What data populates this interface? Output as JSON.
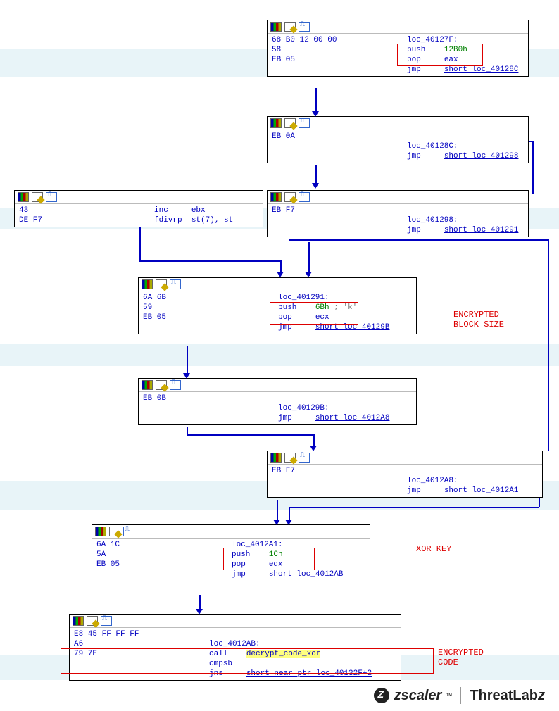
{
  "nodes": {
    "n1": {
      "hex": "68 B0 12 00 00\n58\nEB 05",
      "loc": "loc_40127F:",
      "lines": [
        {
          "m": "push",
          "o": "12B0h",
          "imm": true
        },
        {
          "m": "pop",
          "o": "eax"
        },
        {
          "m": "jmp",
          "o": "short loc_40128C"
        }
      ]
    },
    "n2": {
      "hex": "EB 0A",
      "loc": "loc_40128C:",
      "lines": [
        {
          "m": "jmp",
          "o": "short loc_401298"
        }
      ]
    },
    "n3a": {
      "hex": "43\nDE F7",
      "lines": [
        {
          "m": "inc",
          "o": "ebx"
        },
        {
          "m": "fdivrp",
          "o": "st(7), st"
        }
      ]
    },
    "n3b": {
      "hex": "EB F7",
      "loc": "loc_401298:",
      "lines": [
        {
          "m": "jmp",
          "o": "short loc_401291"
        }
      ]
    },
    "n4": {
      "hex": "6A 6B\n59\nEB 05",
      "loc": "loc_401291:",
      "lines": [
        {
          "m": "push",
          "o": "6Bh",
          "imm": true,
          "cmt": "; 'k'"
        },
        {
          "m": "pop",
          "o": "ecx"
        },
        {
          "m": "jmp",
          "o": "short loc_40129B"
        }
      ]
    },
    "n5": {
      "hex": "EB 0B",
      "loc": "loc_40129B:",
      "lines": [
        {
          "m": "jmp",
          "o": "short loc_4012A8"
        }
      ]
    },
    "n6": {
      "hex": "EB F7",
      "loc": "loc_4012A8:",
      "lines": [
        {
          "m": "jmp",
          "o": "short loc_4012A1"
        }
      ]
    },
    "n7": {
      "hex": "6A 1C\n5A\nEB 05",
      "loc": "loc_4012A1:",
      "lines": [
        {
          "m": "push",
          "o": "1Ch",
          "imm": true
        },
        {
          "m": "pop",
          "o": "edx"
        },
        {
          "m": "jmp",
          "o": "short loc_4012AB"
        }
      ]
    },
    "n8": {
      "hex": "E8 45 FF FF FF\nA6\n79 7E",
      "loc": "loc_4012AB:",
      "lines": [
        {
          "m": "call",
          "o": "decrypt_code_xor",
          "hl": true
        },
        {
          "m": "cmpsb",
          "o": ""
        },
        {
          "m": "jns",
          "o": "short near ptr loc_40132F+2"
        }
      ]
    }
  },
  "annotations": {
    "a1": "ENCRYPTED\nBLOCK SIZE",
    "a2": "XOR KEY",
    "a3": "ENCRYPTED\nCODE"
  },
  "footer": {
    "brand1": "zscaler",
    "brand2": "ThreatLabz"
  }
}
